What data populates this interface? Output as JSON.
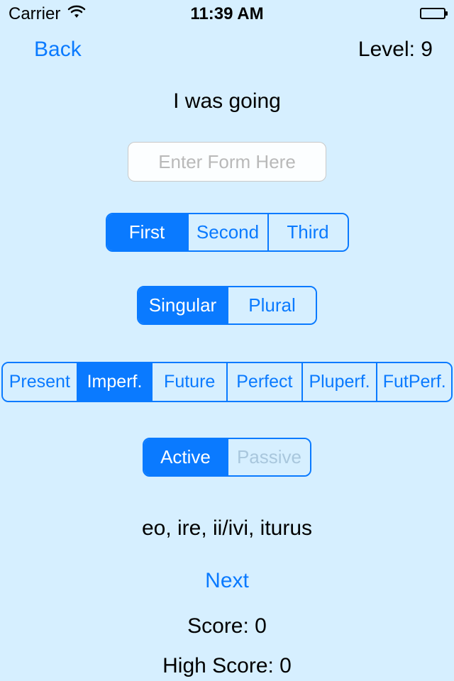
{
  "statusBar": {
    "carrier": "Carrier",
    "time": "11:39 AM"
  },
  "nav": {
    "back": "Back",
    "level": "Level: 9"
  },
  "prompt": "I was going",
  "input": {
    "placeholder": "Enter Form Here",
    "value": ""
  },
  "person": {
    "options": [
      "First",
      "Second",
      "Third"
    ],
    "selected": 0
  },
  "number": {
    "options": [
      "Singular",
      "Plural"
    ],
    "selected": 0
  },
  "tense": {
    "options": [
      "Present",
      "Imperf.",
      "Future",
      "Perfect",
      "Pluperf.",
      "FutPerf."
    ],
    "selected": 1
  },
  "voice": {
    "options": [
      "Active",
      "Passive"
    ],
    "selected": 0,
    "disabled": [
      1
    ]
  },
  "verbForms": "eo, ire, ii/ivi, iturus",
  "nextLabel": "Next",
  "score": "Score: 0",
  "highScore": "High Score: 0"
}
